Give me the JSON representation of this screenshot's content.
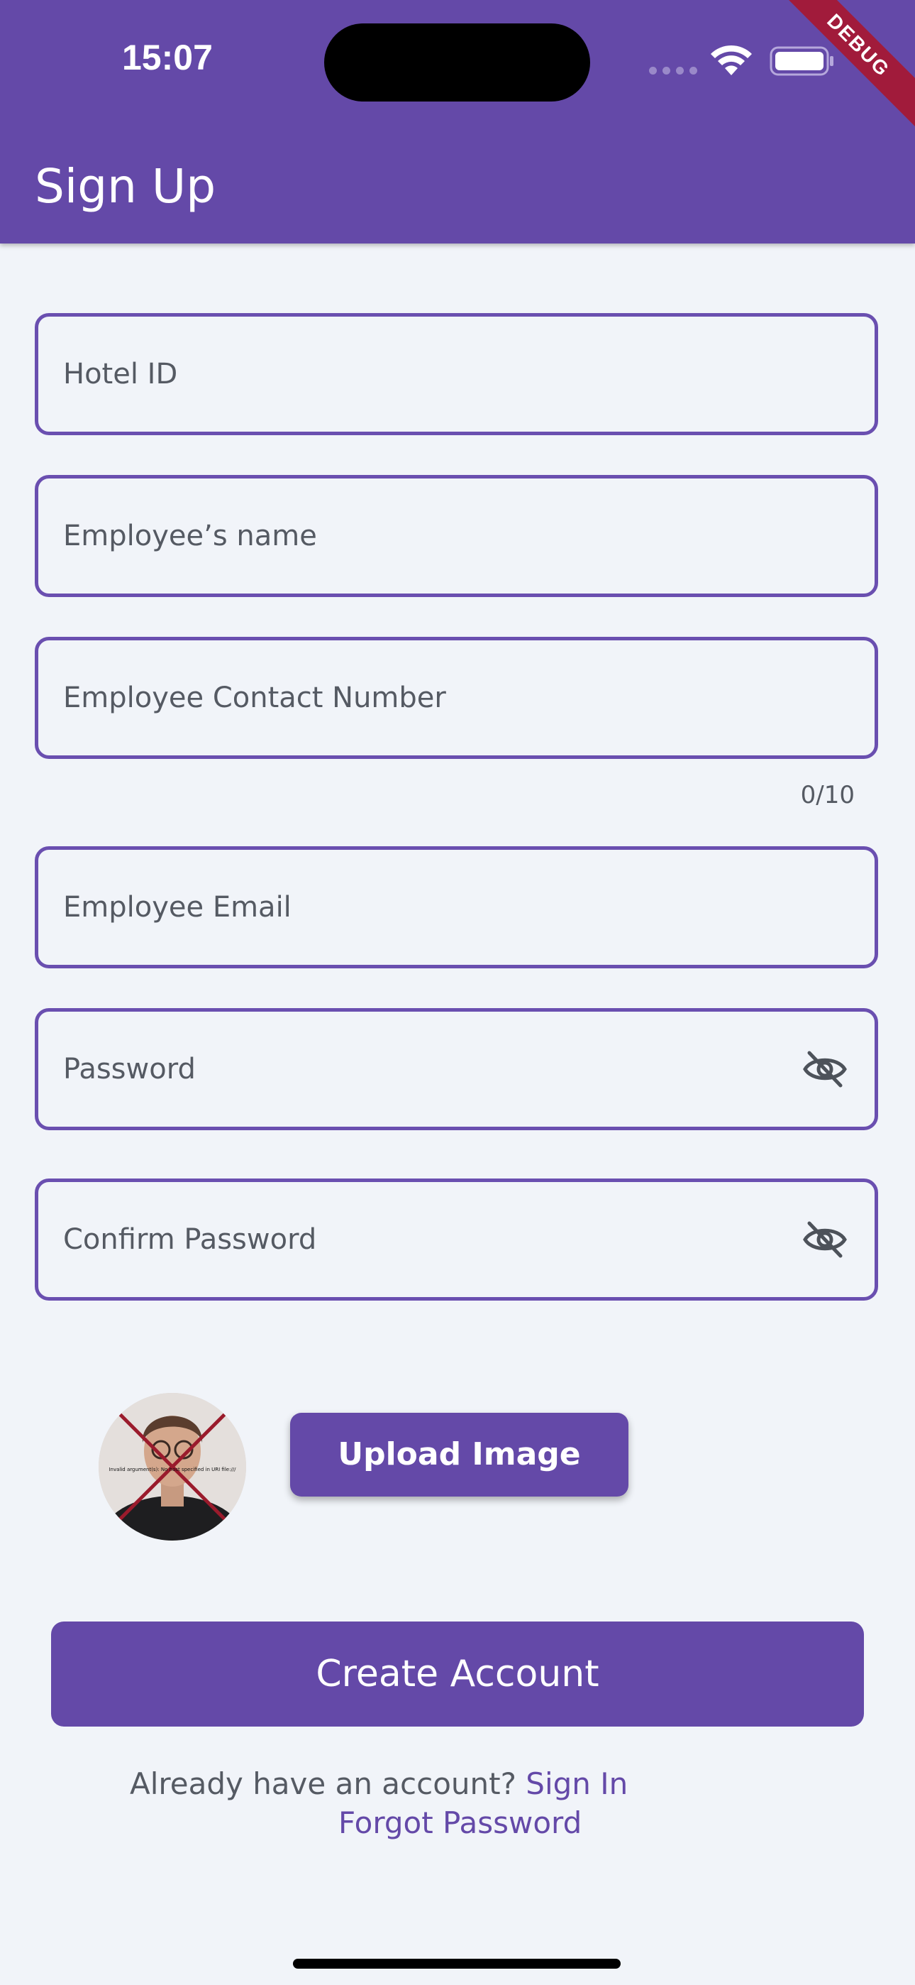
{
  "status_bar": {
    "time": "15:07"
  },
  "debug_banner": "DEBUG",
  "app_bar": {
    "title": "Sign Up"
  },
  "form": {
    "hotel_id": {
      "placeholder": "Hotel ID"
    },
    "employee_name": {
      "placeholder": "Employee’s name"
    },
    "contact_number": {
      "placeholder": "Employee Contact Number",
      "counter": "0/10"
    },
    "email": {
      "placeholder": "Employee Email"
    },
    "password": {
      "placeholder": "Password",
      "icon": "visibility-off-icon"
    },
    "confirm_password": {
      "placeholder": "Confirm Password",
      "icon": "visibility-off-icon"
    }
  },
  "image_upload": {
    "button_label": "Upload Image",
    "error_text": "Invalid argument(s): No host specified in URI file:///"
  },
  "create_account": {
    "label": "Create Account"
  },
  "footer": {
    "prompt": "Already have an account?",
    "sign_in": "Sign In",
    "forgot_password": "Forgot Password"
  },
  "colors": {
    "primary": "#6449a8",
    "background": "#f1f4f9",
    "debug": "#a11b3b"
  }
}
